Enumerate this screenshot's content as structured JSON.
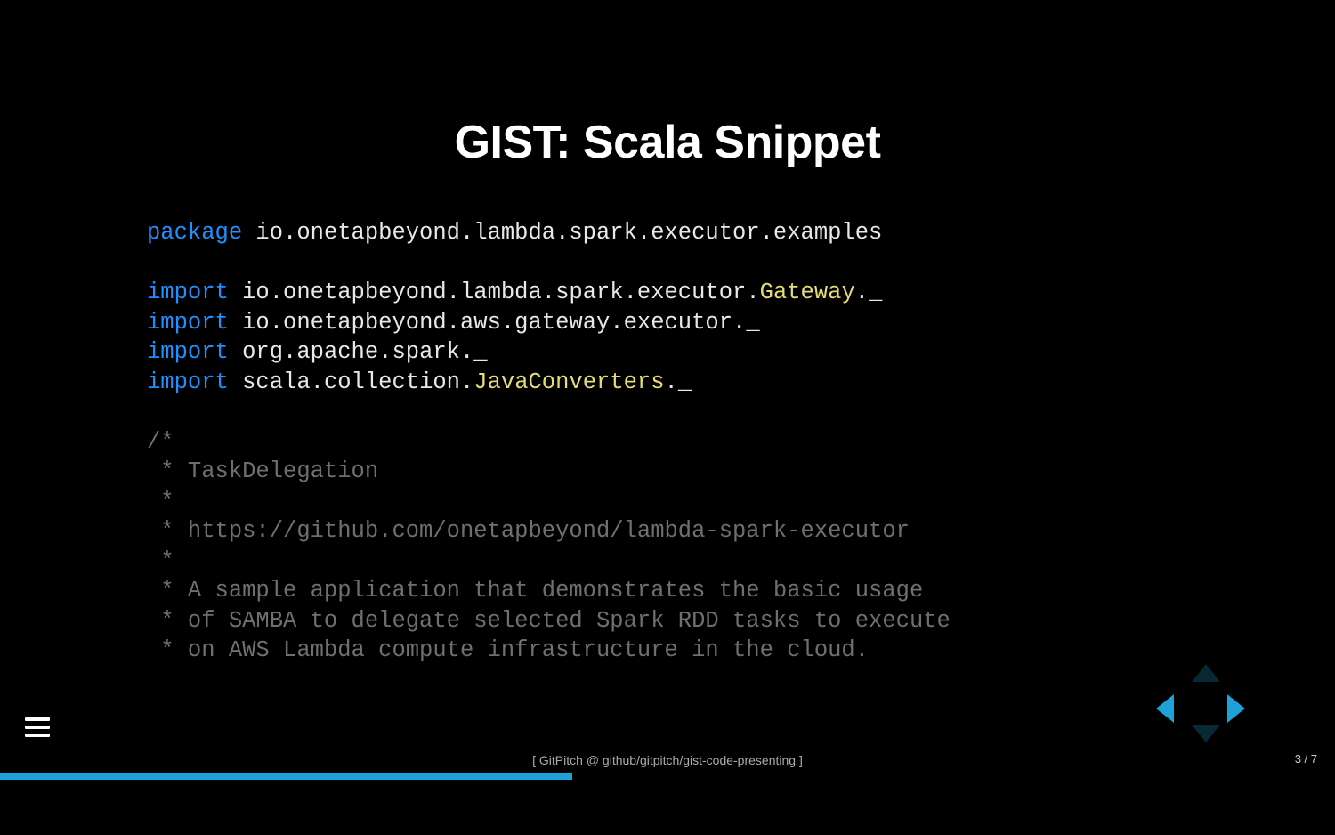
{
  "title": "GIST: Scala Snippet",
  "code_tokens": [
    [
      {
        "t": "package",
        "c": "keyword"
      },
      {
        "t": " io.onetapbeyond.lambda.spark.executor.examples",
        "c": "default"
      }
    ],
    [],
    [
      {
        "t": "import",
        "c": "keyword"
      },
      {
        "t": " io.onetapbeyond.lambda.spark.executor.",
        "c": "default"
      },
      {
        "t": "Gateway",
        "c": "type"
      },
      {
        "t": "._",
        "c": "default"
      }
    ],
    [
      {
        "t": "import",
        "c": "keyword"
      },
      {
        "t": " io.onetapbeyond.aws.gateway.executor._",
        "c": "default"
      }
    ],
    [
      {
        "t": "import",
        "c": "keyword"
      },
      {
        "t": " org.apache.spark._",
        "c": "default"
      }
    ],
    [
      {
        "t": "import",
        "c": "keyword"
      },
      {
        "t": " scala.collection.",
        "c": "default"
      },
      {
        "t": "JavaConverters",
        "c": "type"
      },
      {
        "t": "._",
        "c": "default"
      }
    ],
    [],
    [
      {
        "t": "/*",
        "c": "comment"
      }
    ],
    [
      {
        "t": " * TaskDelegation",
        "c": "comment"
      }
    ],
    [
      {
        "t": " *",
        "c": "comment"
      }
    ],
    [
      {
        "t": " * https://github.com/onetapbeyond/lambda-spark-executor",
        "c": "comment"
      }
    ],
    [
      {
        "t": " *",
        "c": "comment"
      }
    ],
    [
      {
        "t": " * A sample application that demonstrates the basic usage",
        "c": "comment"
      }
    ],
    [
      {
        "t": " * of SAMBA to delegate selected Spark RDD tasks to execute",
        "c": "comment"
      }
    ],
    [
      {
        "t": " * on AWS Lambda compute infrastructure in the cloud.",
        "c": "comment"
      }
    ]
  ],
  "footer": "[ GitPitch @ github/gitpitch/gist-code-presenting ]",
  "page": {
    "current": 3,
    "total": 7,
    "display": "3 / 7"
  },
  "progress_percent": 42.857,
  "accent_color": "#1ea0d9",
  "nav": {
    "up_enabled": false,
    "down_enabled": false,
    "left_enabled": true,
    "right_enabled": true
  }
}
